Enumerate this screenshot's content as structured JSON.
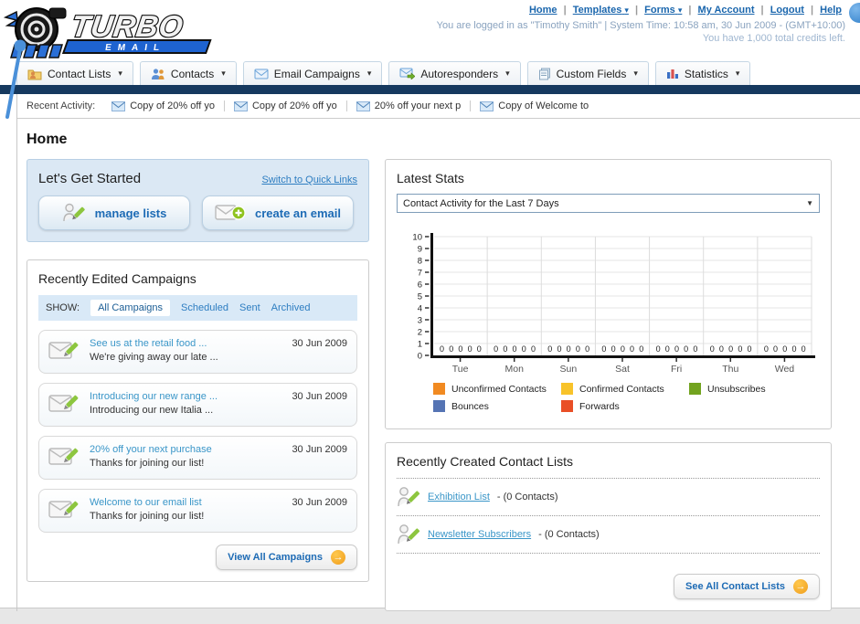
{
  "header": {
    "logo_line1": "TURBO",
    "logo_line2": "EMAIL",
    "links": {
      "home": "Home",
      "templates": "Templates",
      "forms": "Forms",
      "my_account": "My Account",
      "logout": "Logout",
      "help": "Help"
    },
    "status_line1": "You are logged in as \"Timothy Smith\" | System Time: 10:58 am, 30 Jun 2009 - (GMT+10:00)",
    "status_line2": "You have 1,000 total credits left."
  },
  "main_nav": [
    {
      "label": "Contact Lists"
    },
    {
      "label": "Contacts"
    },
    {
      "label": "Email Campaigns"
    },
    {
      "label": "Autoresponders"
    },
    {
      "label": "Custom Fields"
    },
    {
      "label": "Statistics"
    }
  ],
  "recent_activity": {
    "label": "Recent Activity:",
    "items": [
      {
        "text": "Copy of 20% off yo"
      },
      {
        "text": "Copy of 20% off yo"
      },
      {
        "text": "20% off your next p"
      },
      {
        "text": "Copy of Welcome to"
      }
    ]
  },
  "page_title": "Home",
  "get_started": {
    "title": "Let's Get Started",
    "switch_link": "Switch to Quick Links",
    "manage_lists_label": "manage lists",
    "create_email_label": "create an email"
  },
  "campaigns": {
    "title": "Recently Edited Campaigns",
    "show_label": "SHOW:",
    "filters": [
      "All Campaigns",
      "Scheduled",
      "Sent",
      "Archived"
    ],
    "active_filter": "All Campaigns",
    "items": [
      {
        "title": "See us at the retail food ...",
        "subtitle": "We're giving away our late ...",
        "date": "30 Jun 2009"
      },
      {
        "title": "Introducing our new range ...",
        "subtitle": "Introducing our new Italia ...",
        "date": "30 Jun 2009"
      },
      {
        "title": "20% off your next purchase",
        "subtitle": "Thanks for joining our list!",
        "date": "30 Jun 2009"
      },
      {
        "title": "Welcome to our email list",
        "subtitle": "Thanks for joining our list!",
        "date": "30 Jun 2009"
      }
    ],
    "view_all_label": "View All Campaigns"
  },
  "stats": {
    "title": "Latest Stats",
    "dropdown_value": "Contact Activity for the Last 7 Days"
  },
  "chart_data": {
    "type": "bar",
    "title": "Contact Activity for the Last 7 Days",
    "categories": [
      "Tue",
      "Mon",
      "Sun",
      "Sat",
      "Fri",
      "Thu",
      "Wed"
    ],
    "series": [
      {
        "name": "Unconfirmed Contacts",
        "color": "#f18a21",
        "values": [
          0,
          0,
          0,
          0,
          0,
          0,
          0
        ]
      },
      {
        "name": "Confirmed Contacts",
        "color": "#f8c32a",
        "values": [
          0,
          0,
          0,
          0,
          0,
          0,
          0
        ]
      },
      {
        "name": "Unsubscribes",
        "color": "#72a31f",
        "values": [
          0,
          0,
          0,
          0,
          0,
          0,
          0
        ]
      },
      {
        "name": "Bounces",
        "color": "#5574b4",
        "values": [
          0,
          0,
          0,
          0,
          0,
          0,
          0
        ]
      },
      {
        "name": "Forwards",
        "color": "#e94f26",
        "values": [
          0,
          0,
          0,
          0,
          0,
          0,
          0
        ]
      }
    ],
    "xlabel": "",
    "ylabel": "",
    "ylim": [
      0,
      10
    ],
    "yticks": [
      0,
      1,
      2,
      3,
      4,
      5,
      6,
      7,
      8,
      9,
      10
    ],
    "grid": true,
    "legend_position": "bottom"
  },
  "contact_lists": {
    "title": "Recently Created Contact Lists",
    "items": [
      {
        "name": "Exhibition List",
        "detail": "- (0 Contacts)"
      },
      {
        "name": "Newsletter Subscribers",
        "detail": "- (0 Contacts)"
      }
    ],
    "see_all_label": "See All Contact Lists"
  }
}
